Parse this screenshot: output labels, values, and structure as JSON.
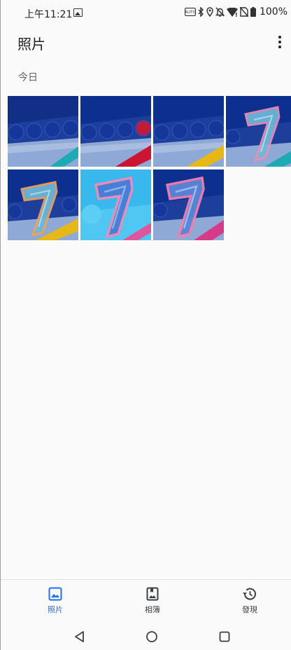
{
  "status_bar": {
    "time": "上午11:21",
    "battery": "100%",
    "icons": [
      "gallery-notification-icon",
      "auto-brightness-icon",
      "bluetooth-icon",
      "location-icon",
      "alarm-off-icon",
      "wifi-icon",
      "no-sim-icon",
      "battery-icon"
    ]
  },
  "app_bar": {
    "title": "照片",
    "menu_icon": "more-vert-icon"
  },
  "section": {
    "label": "今日"
  },
  "photos": [
    {
      "name": "photo-1",
      "theme": "blue-circles-teal"
    },
    {
      "name": "photo-2",
      "theme": "blue-circles-red"
    },
    {
      "name": "photo-3",
      "theme": "blue-circles-yellow"
    },
    {
      "name": "photo-4",
      "theme": "seven-teal"
    },
    {
      "name": "photo-5",
      "theme": "seven-yellow"
    },
    {
      "name": "photo-6",
      "theme": "seven-light-blue"
    },
    {
      "name": "photo-7",
      "theme": "seven-pink"
    }
  ],
  "bottom_nav": {
    "photos_label": "照片",
    "albums_label": "相簿",
    "discover_label": "發現",
    "active": "photos",
    "active_color": "#1a73e8"
  },
  "system_nav": {
    "back_icon": "back-triangle-icon",
    "home_icon": "home-circle-icon",
    "recents_icon": "recents-square-icon"
  }
}
